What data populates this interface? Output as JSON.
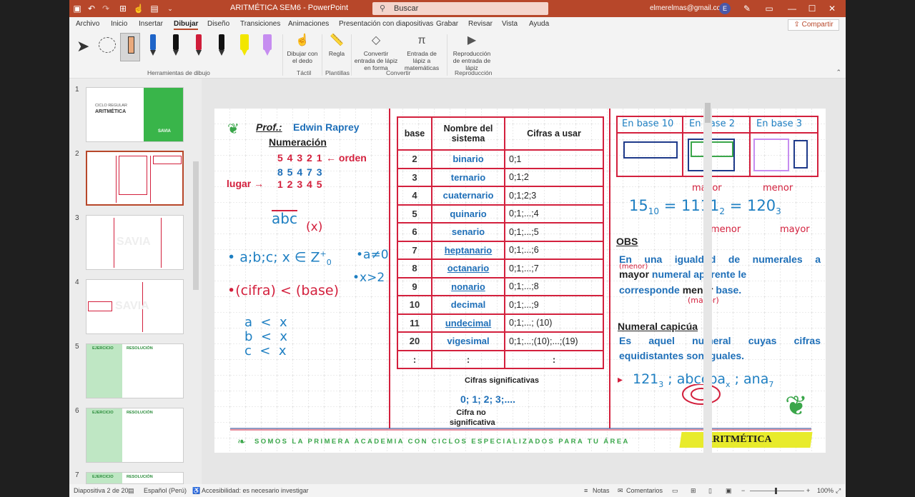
{
  "window": {
    "title": "ARITMÉTICA SEM6  -  PowerPoint",
    "search_label": "Buscar",
    "user_email": "elmerelmas@gmail.com",
    "avatar_letter": "E"
  },
  "menubar": {
    "items": [
      "Archivo",
      "Inicio",
      "Insertar",
      "Dibujar",
      "Diseño",
      "Transiciones",
      "Animaciones",
      "Presentación con diapositivas",
      "Grabar",
      "Revisar",
      "Vista",
      "Ayuda"
    ],
    "active": "Dibujar",
    "share_label": "Compartir"
  },
  "ribbon": {
    "group_drawing_tools": "Herramientas de dibujo",
    "finger": "Dibujar con el dedo",
    "group_touch": "Táctil",
    "ruler": "Regla",
    "group_templates": "Plantillas",
    "ink_to_shape": "Convertir entrada de lápiz en forma",
    "ink_to_math": "Entrada de lápiz a matemáticas",
    "group_convert": "Convertir",
    "ink_replay": "Reproducción de entrada de lápiz",
    "group_replay": "Reproducción",
    "pen_colors": [
      "#ffffff",
      "#1e64c8",
      "#111111",
      "#d01d3a",
      "#111111",
      "#f2e600",
      "#c68df0"
    ]
  },
  "thumbnails": {
    "numbers": [
      "1",
      "2",
      "3",
      "4",
      "5",
      "6",
      "7"
    ],
    "slide1_sub": "CICLO REGULAR",
    "slide1_title": "ARITMÉTICA",
    "slide1_brand": "SAVIA",
    "ejercicio": "EJERCICIO",
    "resolucion": "RESOLUCIÓN",
    "watermark": "SAVIA"
  },
  "slide": {
    "prof_label": "Prof.:",
    "prof_name": "Edwin Raprey",
    "numeracion": "Numeración",
    "row_orden_digits": "5 4 3 2 1",
    "orden_label": "← orden",
    "row_number": "8 5 4 7 3",
    "lugar_label": "lugar →",
    "row_lugar_digits": "1 2 3 4 5",
    "hw_abc": "abc",
    "hw_base_x": "(x)",
    "hw_condition": "• a;b;c; x ∈ Z",
    "hw_Z_sup": "+",
    "hw_Z_sub": "0",
    "hw_a_neq_0": "•a≠0",
    "hw_x_gt_2": "•x>2",
    "hw_cifra_base": "•(cifra) < (base)",
    "hw_a_lt_x": "a  <  x",
    "hw_b_lt_x": "b  <  x",
    "hw_c_lt_x": "c  <  x",
    "table": {
      "headers": [
        "base",
        "Nombre del sistema",
        "Cifras a usar"
      ],
      "rows": [
        {
          "base": "2",
          "name": "binario",
          "digits": "0;1"
        },
        {
          "base": "3",
          "name": "ternario",
          "digits": "0;1;2"
        },
        {
          "base": "4",
          "name": "cuaternario",
          "digits": "0;1;2;3"
        },
        {
          "base": "5",
          "name": "quinario",
          "digits": "0;1;...;4"
        },
        {
          "base": "6",
          "name": "senario",
          "digits": "0;1;...;5"
        },
        {
          "base": "7",
          "name": "heptanario",
          "digits": "0;1;...;6"
        },
        {
          "base": "8",
          "name": "octanario",
          "digits": "0;1;...;7"
        },
        {
          "base": "9",
          "name": "nonario",
          "digits": "0;1;...;8"
        },
        {
          "base": "10",
          "name": "decimal",
          "digits": "0;1;...;9"
        },
        {
          "base": "11",
          "name": "undecimal",
          "digits": "0;1;...; (10)"
        },
        {
          "base": "20",
          "name": "vigesimal",
          "digits": "0;1;...;(10);...;(19)"
        },
        {
          "base": ":",
          "name": ":",
          "digits": ":"
        }
      ]
    },
    "cifras_significativas": "Cifras significativas",
    "digits_sequence": "0; 1; 2; 3;....",
    "cifra_no_significativa": "Cifra no significativa",
    "base_headers": [
      "En base 10",
      "En base 2",
      "En base 3"
    ],
    "hw_mayor_top": "mayor",
    "hw_menor_top": "menor",
    "hw_equation": "15",
    "hw_eq_sub10": "10",
    "hw_eq_mid": " = 1111",
    "hw_eq_sub2": "2",
    "hw_eq_end": " = 120",
    "hw_eq_sub3": "3",
    "hw_menor_bottom": "menor",
    "hw_mayor_bottom": "mayor",
    "obs_title": "OBS",
    "obs_line1": "En una igualdad de numerales a",
    "obs_line2_a": "mayor",
    "obs_line2_b": " numeral aparente le",
    "obs_line3_a": "corresponde ",
    "obs_line3_b": "menor",
    "obs_line3_c": " base.",
    "hw_menor_note": "(menor)",
    "hw_mayor_note": "(mayor)",
    "capicua_title": "Numeral capicúa",
    "capicua_line1": "Es aquel numeral cuyas cifras",
    "capicua_line2": "equidistantes son iguales.",
    "hw_capicua_examples": "121",
    "hw_cap_sub3": "3",
    "hw_cap_mid": " ; abccba",
    "hw_cap_subx": "x",
    "hw_cap_end": " ; ana",
    "hw_cap_sub7": "7",
    "footer_text": "SOMOS LA PRIMERA ACADEMIA CON CICLOS ESPECIALIZADOS PARA TU ÁREA",
    "footer_subject": "ARITMÉTICA"
  },
  "statusbar": {
    "slide_info": "Diapositiva 2 de 20",
    "language": "Español (Perú)",
    "accessibility": "Accesibilidad: es necesario investigar",
    "notes": "Notas",
    "comments": "Comentarios",
    "zoom": "100%"
  }
}
